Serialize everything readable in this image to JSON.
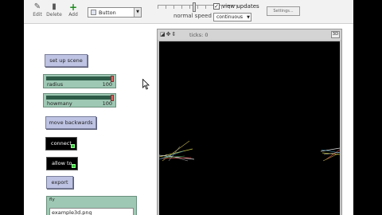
{
  "toolbar": {
    "edit_label": "Edit",
    "delete_label": "Delete",
    "add_label": "Add",
    "widget_type": "Button",
    "speed_label": "normal speed",
    "view_updates_label": "view updates",
    "view_updates_checked": "✓",
    "update_mode": "continuous",
    "settings_label": "Settings..."
  },
  "widgets": {
    "setup_label": "set up scene",
    "radius": {
      "name": "radius",
      "value": "100"
    },
    "howmany": {
      "name": "howmany",
      "value": "100"
    },
    "move_backwards_label": "move backwards",
    "connect_label": "connect",
    "allow_to_label": "allow to",
    "export_label": "export",
    "input": {
      "label": "fly",
      "value": "example3d.png"
    }
  },
  "view": {
    "ticks_label": "ticks: 0",
    "zoom_label": "3D"
  },
  "colors": {
    "button": "#bec3e3",
    "slider": "#9ec8b3",
    "world": "#000000"
  }
}
